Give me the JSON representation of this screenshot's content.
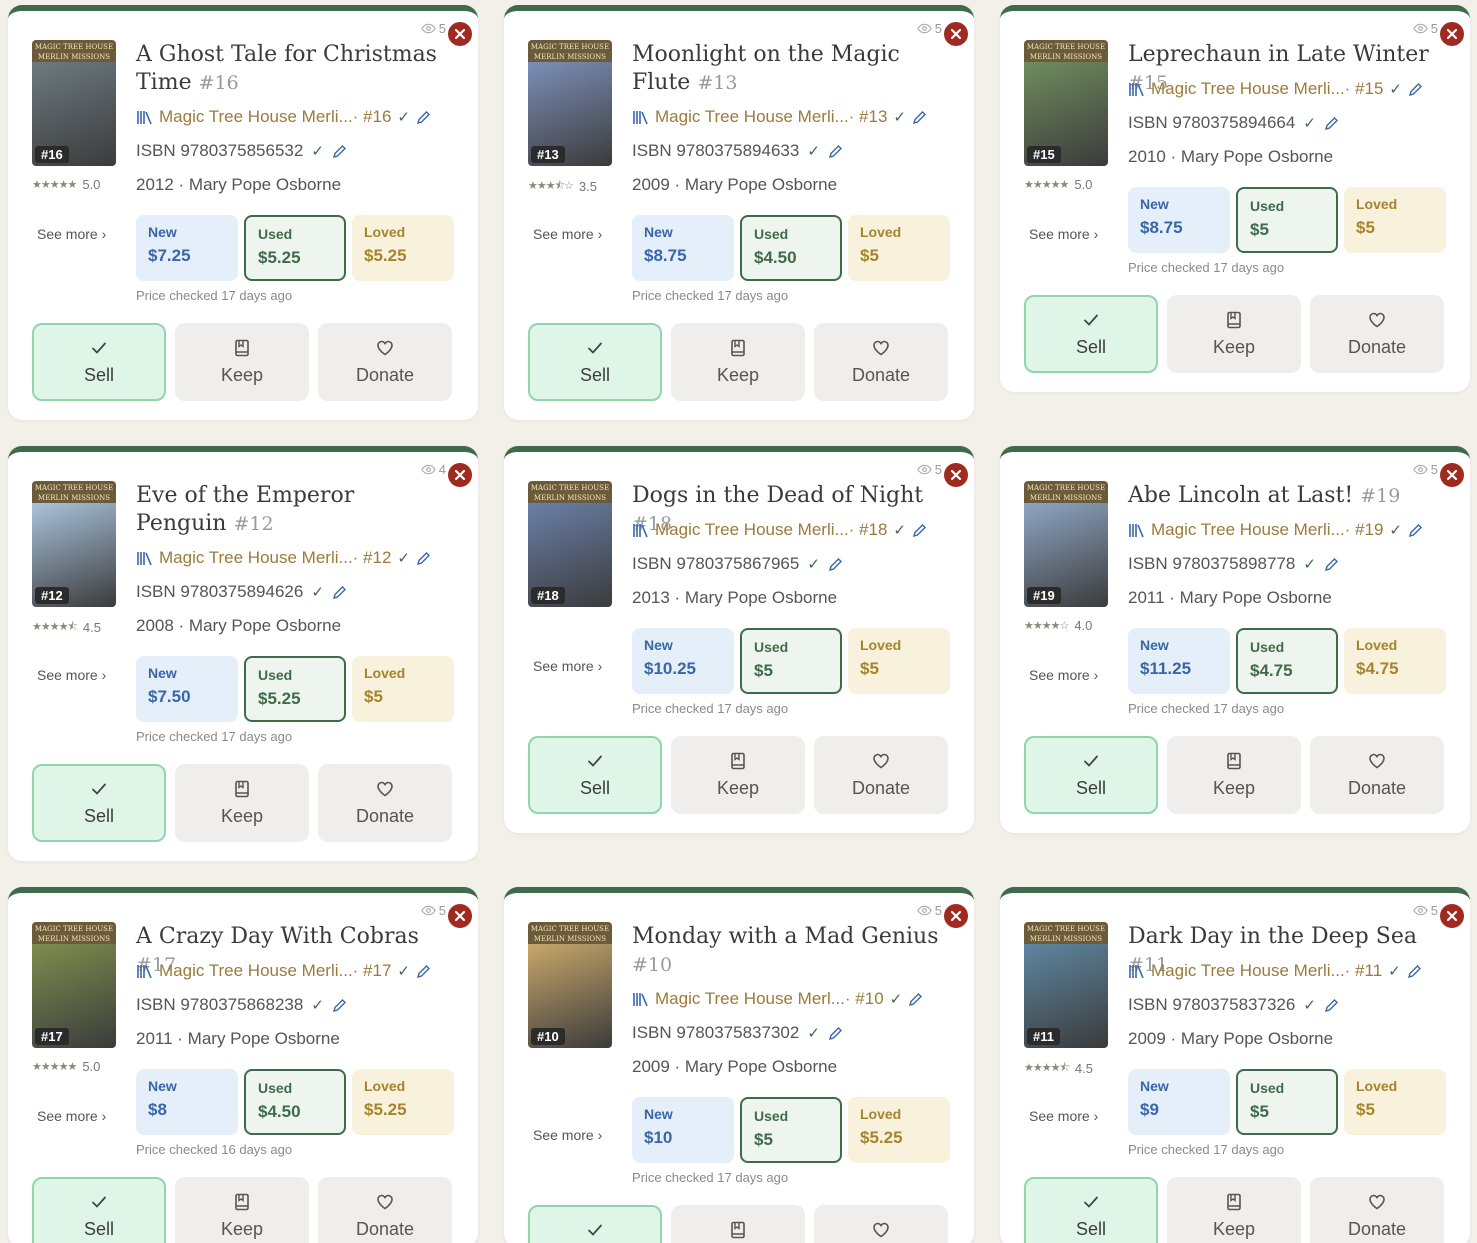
{
  "labels": {
    "see_more": "See more ›",
    "sell": "Sell",
    "keep": "Keep",
    "donate": "Donate",
    "new": "New",
    "used": "Used",
    "loved": "Loved",
    "series_prefix": "Magic Tree House Merli...",
    "cover_series": "MAGIC TREE HOUSE MERLIN MISSIONS"
  },
  "colors": {
    "accent_green": "#3f6b4c",
    "close_red": "#a02a22",
    "series_gold": "#9a7b3a",
    "new_blue": "#3a66a8",
    "loved_gold": "#a6842e"
  },
  "books": [
    {
      "title": "A Ghost Tale for Christmas Time",
      "num": "#16",
      "cover_num": "#16",
      "series": "Magic Tree House Merli...· #16",
      "isbn": "ISBN 9780375856532",
      "meta": "2012 · Mary Pope Osborne",
      "rating": "5.0",
      "stars": 5,
      "views": "5",
      "new": "$7.25",
      "used": "$5.25",
      "loved": "$5.25",
      "checked": "Price checked 17 days ago",
      "art": "#6d7a80"
    },
    {
      "title": "Moonlight on the Magic Flute",
      "num": "#13",
      "cover_num": "#13",
      "series": "Magic Tree House Merli...· #13",
      "isbn": "ISBN 9780375894633",
      "meta": "2009 · Mary Pope Osborne",
      "rating": "3.5",
      "stars": 3.5,
      "views": "5",
      "new": "$8.75",
      "used": "$4.50",
      "loved": "$5",
      "checked": "Price checked 17 days ago",
      "art": "#7c8fb8"
    },
    {
      "title": "Leprechaun in Late Winter",
      "num": "#15",
      "cover_num": "#15",
      "series": "Magic Tree House Merli...· #15",
      "isbn": "ISBN 9780375894664",
      "meta": "2010 · Mary Pope Osborne",
      "rating": "5.0",
      "stars": 5,
      "views": "5",
      "new": "$8.75",
      "used": "$5",
      "loved": "$5",
      "checked": "Price checked 17 days ago",
      "art": "#6f8c5e"
    },
    {
      "title": "Eve of the Emperor Penguin",
      "num": "#12",
      "cover_num": "#12",
      "series": "Magic Tree House Merli...· #12",
      "isbn": "ISBN 9780375894626",
      "meta": "2008 · Mary Pope Osborne",
      "rating": "4.5",
      "stars": 4.5,
      "views": "4",
      "new": "$7.50",
      "used": "$5.25",
      "loved": "$5",
      "checked": "Price checked 17 days ago",
      "art": "#a9c3dd"
    },
    {
      "title": "Dogs in the Dead of Night",
      "num": "#18",
      "cover_num": "#18",
      "series": "Magic Tree House Merli...· #18",
      "isbn": "ISBN 9780375867965",
      "meta": "2013 · Mary Pope Osborne",
      "rating": "",
      "stars": 0,
      "views": "5",
      "new": "$10.25",
      "used": "$5",
      "loved": "$5",
      "checked": "Price checked 17 days ago",
      "art": "#6a7fa8"
    },
    {
      "title": "Abe Lincoln at Last!",
      "num": "#19",
      "cover_num": "#19",
      "series": "Magic Tree House Merli...· #19",
      "isbn": "ISBN 9780375898778",
      "meta": "2011 · Mary Pope Osborne",
      "rating": "4.0",
      "stars": 4,
      "views": "5",
      "new": "$11.25",
      "used": "$4.75",
      "loved": "$4.75",
      "checked": "Price checked 17 days ago",
      "art": "#8ea6c4"
    },
    {
      "title": "A Crazy Day With Cobras",
      "num": "#17",
      "cover_num": "#17",
      "series": "Magic Tree House Merli...· #17",
      "isbn": "ISBN 9780375868238",
      "meta": "2011 · Mary Pope Osborne",
      "rating": "5.0",
      "stars": 5,
      "views": "5",
      "new": "$8",
      "used": "$4.50",
      "loved": "$5.25",
      "checked": "Price checked 16 days ago",
      "art": "#7d8e4d"
    },
    {
      "title": "Monday with a Mad Genius",
      "num": "#10",
      "cover_num": "#10",
      "series": "Magic Tree House Merl...· #10",
      "isbn": "ISBN 9780375837302",
      "meta": "2009 · Mary Pope Osborne",
      "rating": "",
      "stars": 0,
      "views": "5",
      "new": "$10",
      "used": "$5",
      "loved": "$5.25",
      "checked": "Price checked 17 days ago",
      "art": "#c8a76a"
    },
    {
      "title": "Dark Day in the Deep Sea",
      "num": "#11",
      "cover_num": "#11",
      "series": "Magic Tree House Merli...· #11",
      "isbn": "ISBN 9780375837326",
      "meta": "2009 · Mary Pope Osborne",
      "rating": "4.5",
      "stars": 4.5,
      "views": "5",
      "new": "$9",
      "used": "$5",
      "loved": "$5",
      "checked": "Price checked 17 days ago",
      "art": "#5d86a0"
    }
  ]
}
